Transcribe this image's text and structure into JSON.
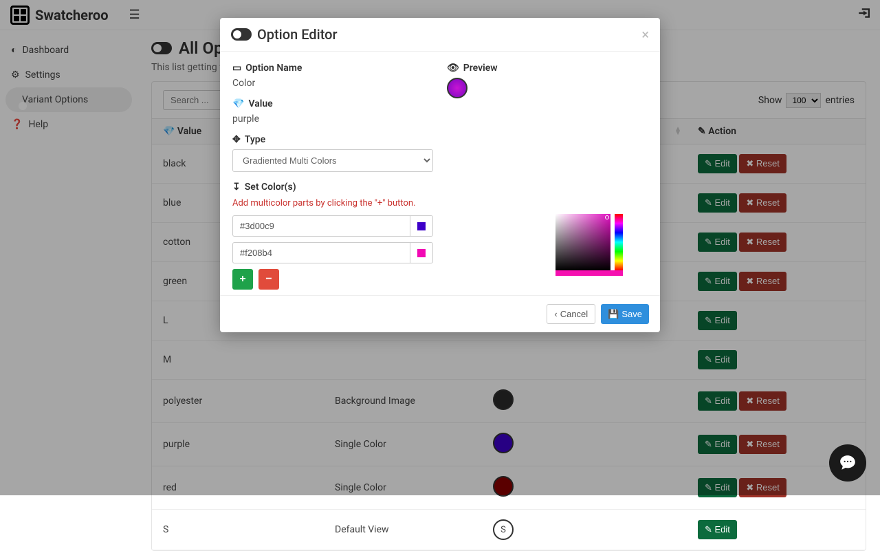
{
  "app": {
    "name": "Swatcheroo"
  },
  "sidebar": {
    "items": [
      {
        "label": "Dashboard"
      },
      {
        "label": "Settings"
      },
      {
        "label": "Variant Options"
      },
      {
        "label": "Help"
      }
    ]
  },
  "page": {
    "title": "All Options",
    "subtitle": "This list getting from"
  },
  "table": {
    "search_placeholder": "Search ...",
    "show_label": "Show",
    "entries_label": "entries",
    "entries_value": "100",
    "columns": {
      "value": "Value",
      "action": "Action"
    },
    "edit": "Edit",
    "reset": "Reset",
    "rows": [
      {
        "value": "black",
        "type": "",
        "swatch": "",
        "reset": true
      },
      {
        "value": "blue",
        "type": "",
        "swatch": "",
        "reset": true
      },
      {
        "value": "cotton",
        "type": "",
        "swatch": "",
        "reset": true
      },
      {
        "value": "green",
        "type": "",
        "swatch": "",
        "reset": true
      },
      {
        "value": "L",
        "type": "",
        "swatch": "",
        "reset": false
      },
      {
        "value": "M",
        "type": "",
        "swatch": "",
        "reset": false
      },
      {
        "value": "polyester",
        "type": "Background Image",
        "swatch": "dark",
        "reset": true
      },
      {
        "value": "purple",
        "type": "Single Color",
        "swatch": "purple",
        "reset": true
      },
      {
        "value": "red",
        "type": "Single Color",
        "swatch": "red",
        "reset": true
      },
      {
        "value": "S",
        "type": "Default View",
        "swatch": "S",
        "reset": false
      }
    ]
  },
  "modal": {
    "title": "Option Editor",
    "option_name_label": "Option Name",
    "option_name_value": "Color",
    "value_label": "Value",
    "value_value": "purple",
    "type_label": "Type",
    "type_value": "Gradiented Multi Colors",
    "set_colors_label": "Set Color(s)",
    "hint": "Add multicolor parts by clicking the \"+\" button.",
    "colors": [
      {
        "hex": "#3d00c9"
      },
      {
        "hex": "#f208b4"
      }
    ],
    "preview_label": "Preview",
    "cancel": "Cancel",
    "save": "Save"
  }
}
